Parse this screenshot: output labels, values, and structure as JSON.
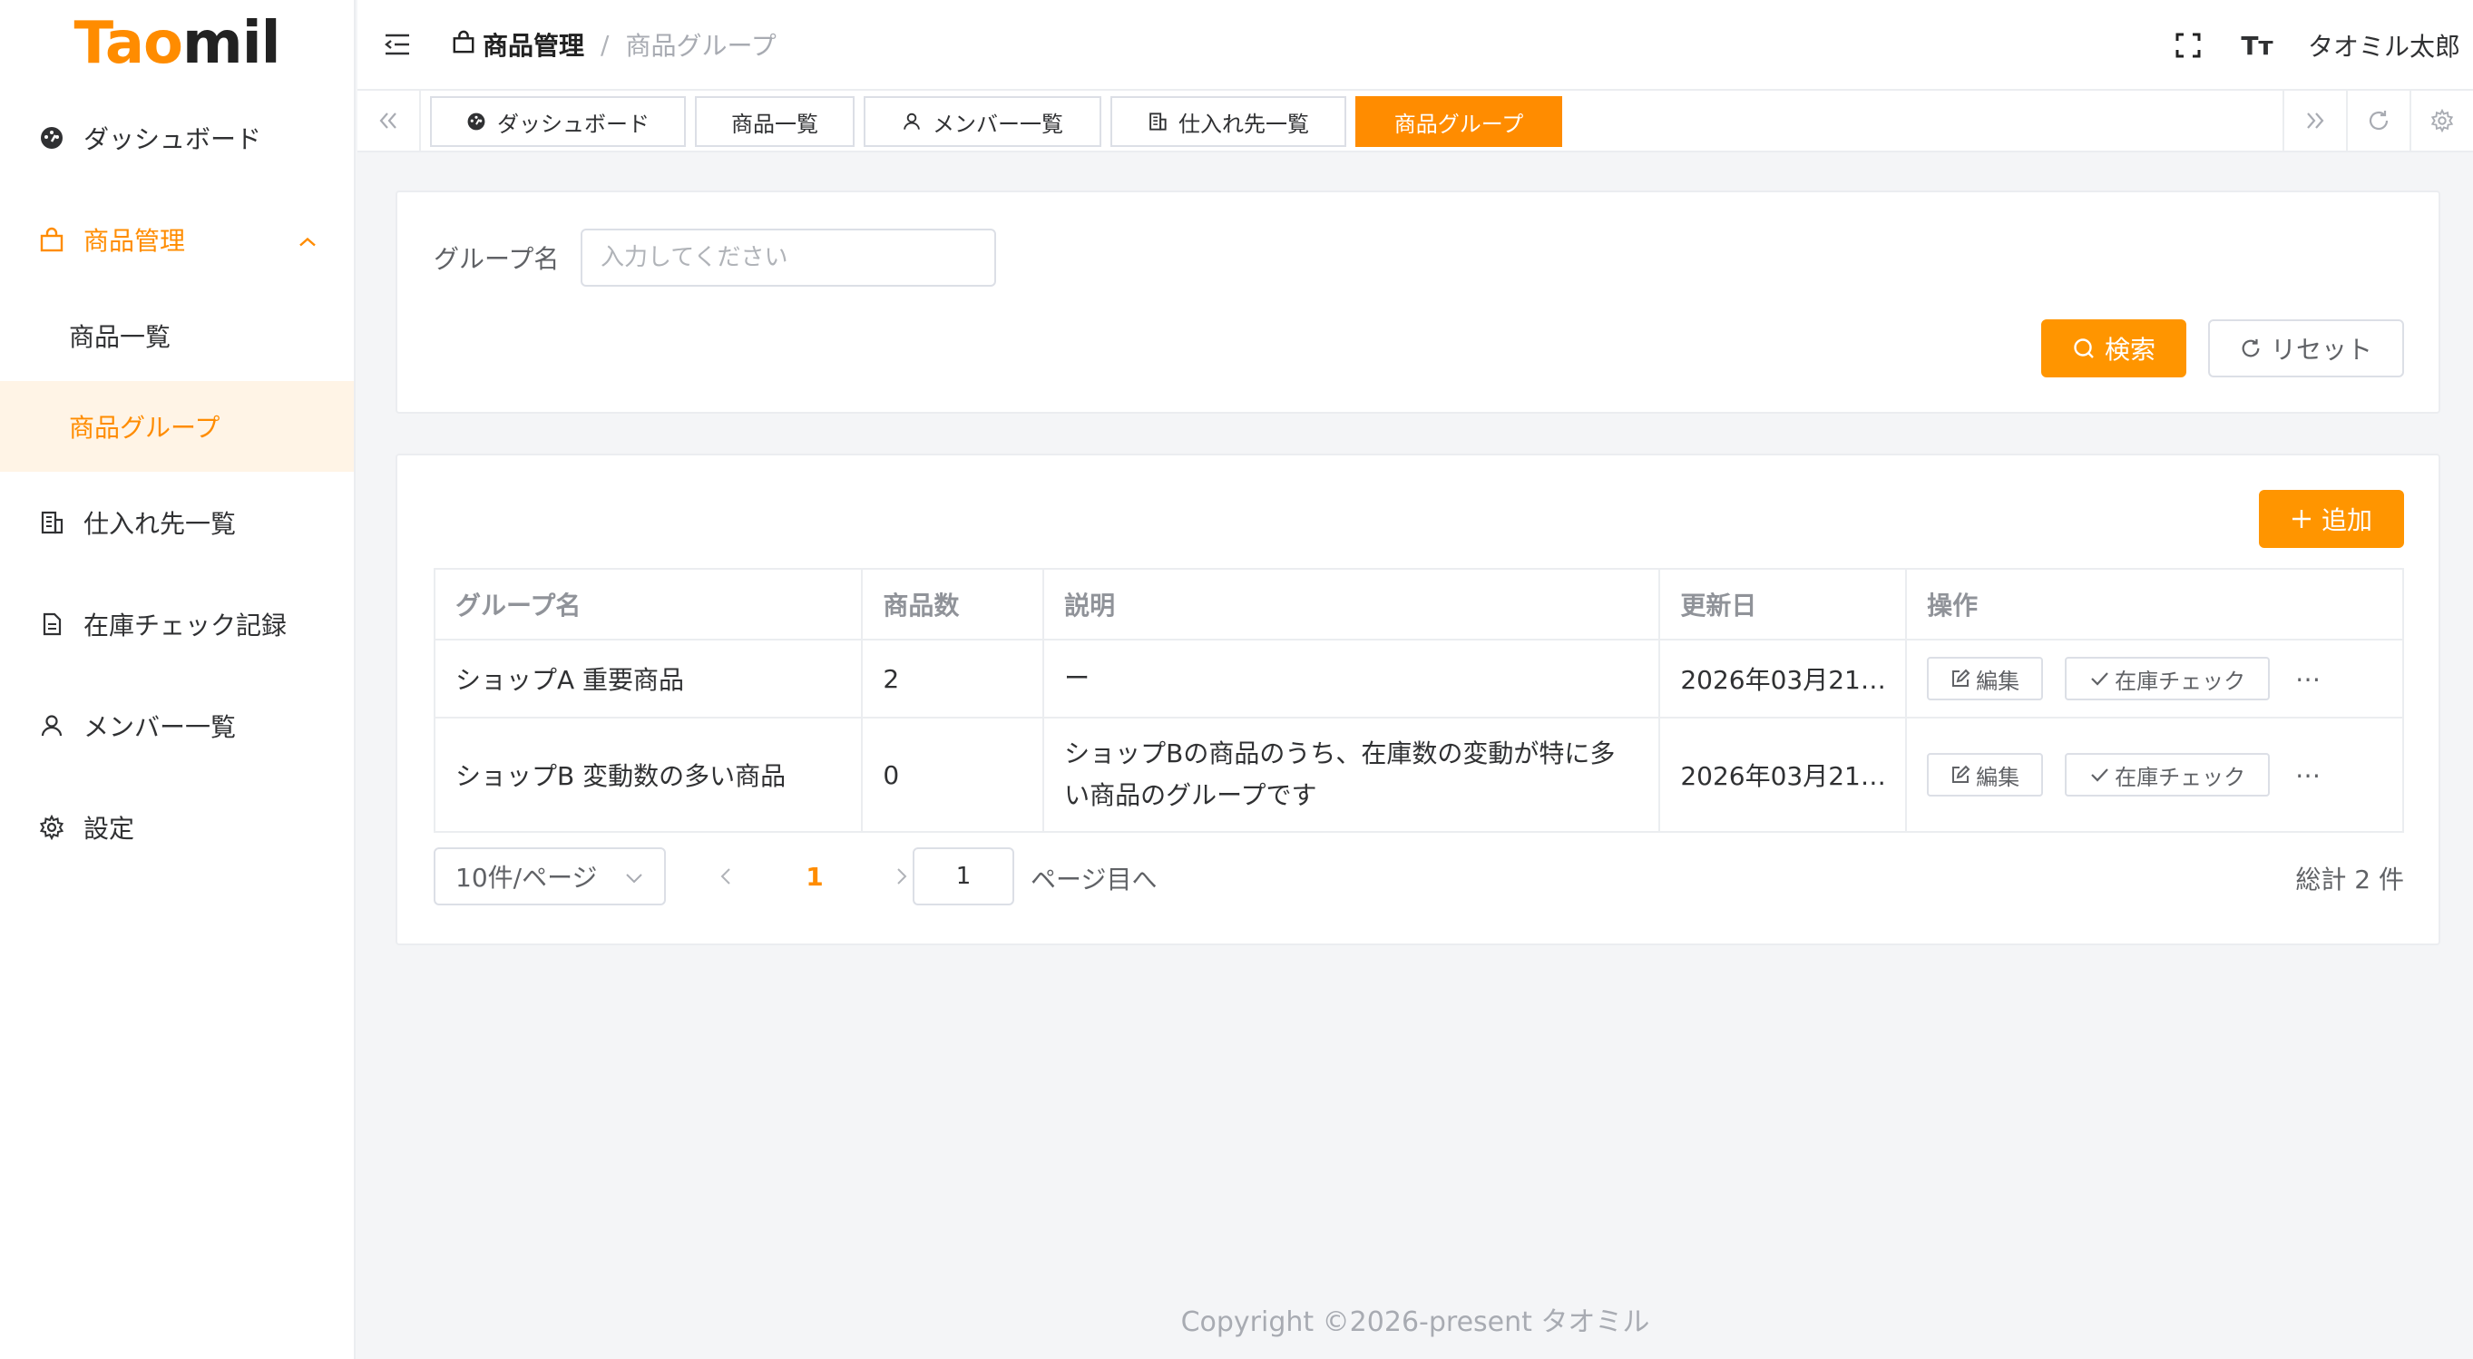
{
  "logo": {
    "part1": "Tao",
    "part2": "mil"
  },
  "sidebar": {
    "items": [
      {
        "label": "ダッシュボード",
        "icon": "dashboard-icon"
      },
      {
        "label": "商品管理",
        "icon": "bag-icon",
        "expanded": true,
        "children": [
          {
            "label": "商品一覧"
          },
          {
            "label": "商品グループ",
            "active": true
          }
        ]
      },
      {
        "label": "仕入れ先一覧",
        "icon": "building-icon"
      },
      {
        "label": "在庫チェック記録",
        "icon": "document-icon"
      },
      {
        "label": "メンバー一覧",
        "icon": "user-icon"
      },
      {
        "label": "設定",
        "icon": "gear-icon"
      }
    ]
  },
  "header": {
    "breadcrumb": [
      "商品管理",
      "商品グループ"
    ],
    "separator": "/",
    "font_size_icon": "Tт",
    "user": "タオミル太郎"
  },
  "tabs": [
    {
      "label": "ダッシュボード",
      "icon": "dashboard-icon"
    },
    {
      "label": "商品一覧"
    },
    {
      "label": "メンバー一覧",
      "icon": "user-icon"
    },
    {
      "label": "仕入れ先一覧",
      "icon": "building-icon"
    },
    {
      "label": "商品グループ",
      "active": true
    }
  ],
  "search": {
    "label": "グループ名",
    "placeholder": "入力してください",
    "search_button": "検索",
    "reset_button": "リセット"
  },
  "table": {
    "add_button": "追加",
    "columns": [
      "グループ名",
      "商品数",
      "説明",
      "更新日",
      "操作"
    ],
    "rows": [
      {
        "name": "ショップA 重要商品",
        "count": "2",
        "desc_line1": "ー",
        "desc_line2": "",
        "updated": "2026年03月21…"
      },
      {
        "name": "ショップB 変動数の多い商品",
        "count": "0",
        "desc_line1": "ショップBの商品のうち、在庫数の変動が特に多",
        "desc_line2": "い商品のグループです",
        "updated": "2026年03月21…"
      }
    ],
    "edit_label": "編集",
    "check_label": "在庫チェック",
    "more_label": "⋯"
  },
  "pagination": {
    "page_size": "10件/ページ",
    "current_page": "1",
    "jump_value": "1",
    "jump_label": "ページ目へ",
    "total": "総計 2 件"
  },
  "footer": {
    "copyright": "Copyright ©2026-present タオミル"
  },
  "colors": {
    "accent": "#ff8c00",
    "accent_light": "#fff4e6",
    "border": "#dcdfe6"
  }
}
